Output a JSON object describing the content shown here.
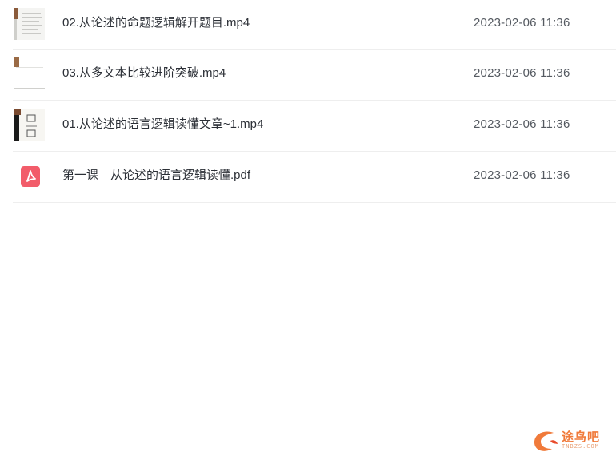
{
  "files": [
    {
      "name": "02.从论述的命题逻辑解开题目.mp4",
      "date": "2023-02-06 11:36",
      "icon": "video-thumbnail-icon",
      "strip_color": "#8a5a3a"
    },
    {
      "name": "03.从多文本比较进阶突破.mp4",
      "date": "2023-02-06 11:36",
      "icon": "video-thumbnail-icon",
      "strip_color": "#9a6a45"
    },
    {
      "name": "01.从论述的语言逻辑读懂文章~1.mp4",
      "date": "2023-02-06 11:36",
      "icon": "video-thumbnail-icon",
      "strip_color": "#1a1a1a"
    },
    {
      "name": "第一课　从论述的语言逻辑读懂.pdf",
      "date": "2023-02-06 11:36",
      "icon": "pdf-file-icon",
      "icon_color": "#f25c6a"
    }
  ],
  "watermark": {
    "text": "途鸟吧",
    "sub": "TNBZS.COM",
    "color": "#f07a3a"
  }
}
